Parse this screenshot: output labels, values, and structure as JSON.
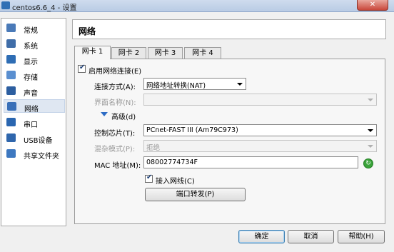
{
  "window": {
    "title": "centos6.6_4 - 设置",
    "close_label": "✕"
  },
  "sidebar": {
    "items": [
      {
        "label": "常规",
        "icon": "general-icon",
        "color": "#4a7ab8"
      },
      {
        "label": "系统",
        "icon": "system-icon",
        "color": "#3f6da8"
      },
      {
        "label": "显示",
        "icon": "display-icon",
        "color": "#2e6db4"
      },
      {
        "label": "存储",
        "icon": "storage-icon",
        "color": "#5a8fd0"
      },
      {
        "label": "声音",
        "icon": "audio-icon",
        "color": "#2c5ea0"
      },
      {
        "label": "网络",
        "icon": "network-icon",
        "color": "#3a70b8"
      },
      {
        "label": "串口",
        "icon": "serial-port-icon",
        "color": "#2a66b0"
      },
      {
        "label": "USB设备",
        "icon": "usb-icon",
        "color": "#2f66ac"
      },
      {
        "label": "共享文件夹",
        "icon": "shared-folder-icon",
        "color": "#3d78c0"
      }
    ],
    "selected": "网络"
  },
  "header": {
    "title": "网络"
  },
  "tabs": [
    {
      "label": "网卡 1"
    },
    {
      "label": "网卡 2"
    },
    {
      "label": "网卡 3"
    },
    {
      "label": "网卡 4"
    }
  ],
  "form": {
    "enable_adapter": {
      "label": "启用网络连接(E)",
      "checked": true
    },
    "attached_to": {
      "label": "连接方式(A):",
      "value": "网络地址转换(NAT)"
    },
    "name": {
      "label": "界面名称(N):",
      "value": ""
    },
    "advanced": {
      "label": "高级(d)"
    },
    "adapter_type": {
      "label": "控制芯片(T):",
      "value": "PCnet-FAST III (Am79C973)"
    },
    "promiscuous": {
      "label": "混杂模式(P):",
      "value": "拒绝"
    },
    "mac": {
      "label": "MAC 地址(M):",
      "value": "08002774734F"
    },
    "cable_connected": {
      "label": "接入网线(C)",
      "checked": true
    },
    "port_forwarding": {
      "label": "端口转发(P)"
    }
  },
  "footer": {
    "ok": "确定",
    "cancel": "取消",
    "help": "帮助(H)"
  }
}
